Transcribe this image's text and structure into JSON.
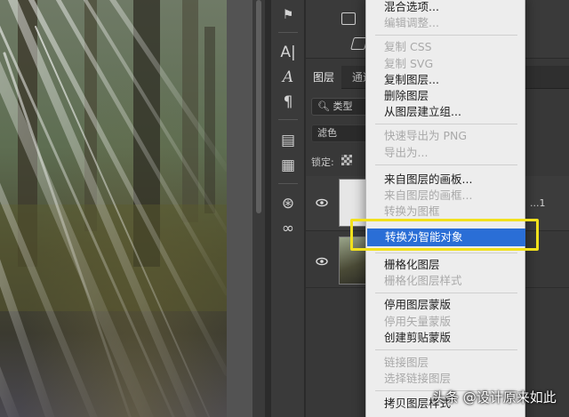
{
  "layers_panel": {
    "tabs": [
      {
        "label": "图层"
      },
      {
        "label": "通道"
      }
    ],
    "filter_kind": "类型",
    "blend_mode": "滤色",
    "lock_label": "锁定:",
    "layer_suffix": "...1"
  },
  "tools": [
    {
      "icon": "character-style-icon",
      "glyph": "A|"
    },
    {
      "icon": "text-icon",
      "glyph": "A"
    },
    {
      "icon": "paragraph-icon",
      "glyph": "¶"
    },
    {
      "icon": "library-icon",
      "glyph": "▤"
    },
    {
      "icon": "document-icon",
      "glyph": "▦"
    },
    {
      "icon": "3d-icon",
      "glyph": "⊛"
    },
    {
      "icon": "creative-cloud-icon",
      "glyph": "∞"
    }
  ],
  "context_menu": {
    "items": [
      {
        "label": "混合选项...",
        "disabled": false
      },
      {
        "label": "编辑调整...",
        "disabled": true
      },
      {
        "label": "复制 CSS",
        "disabled": true
      },
      {
        "label": "复制 SVG",
        "disabled": true
      },
      {
        "label": "复制图层...",
        "disabled": false
      },
      {
        "label": "删除图层",
        "disabled": false
      },
      {
        "label": "从图层建立组...",
        "disabled": false
      },
      {
        "label": "快速导出为 PNG",
        "disabled": true
      },
      {
        "label": "导出为...",
        "disabled": true
      },
      {
        "label": "来自图层的画板...",
        "disabled": false
      },
      {
        "label": "来自图层的画框...",
        "disabled": true
      },
      {
        "label": "转换为图框",
        "disabled": true
      },
      {
        "label": "转换为智能对象",
        "disabled": false,
        "highlighted": true
      },
      {
        "label": "栅格化图层",
        "disabled": false
      },
      {
        "label": "栅格化图层样式",
        "disabled": true
      },
      {
        "label": "停用图层蒙版",
        "disabled": false
      },
      {
        "label": "停用矢量蒙版",
        "disabled": true
      },
      {
        "label": "创建剪贴蒙版",
        "disabled": false
      },
      {
        "label": "链接图层",
        "disabled": true
      },
      {
        "label": "选择链接图层",
        "disabled": true
      },
      {
        "label": "拷贝图层样式",
        "disabled": false
      }
    ]
  },
  "watermark": "头条 @设计原来如此",
  "colors": {
    "highlight": "#2a6ed6",
    "annotation_box": "#f2e11c",
    "menu_bg": "#ededed"
  }
}
